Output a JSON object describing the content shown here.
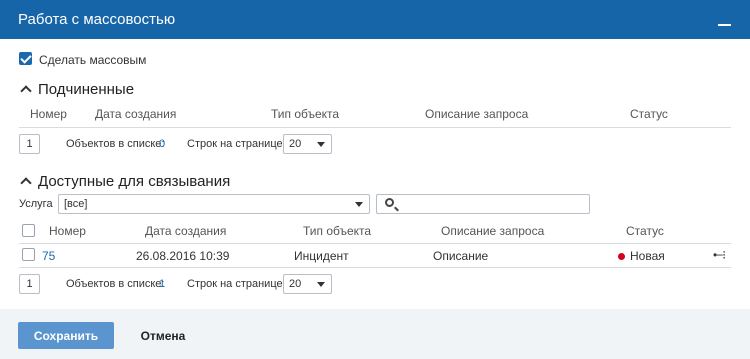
{
  "dialog": {
    "title": "Работа с массовостью"
  },
  "make_mass": {
    "label": "Сделать массовым",
    "checked": true
  },
  "subordinates": {
    "title": "Подчиненные",
    "columns": [
      "Номер",
      "Дата создания",
      "Тип объекта",
      "Описание запроса",
      "Статус"
    ],
    "pager": {
      "page": "1",
      "objects_label": "Объектов в списке:",
      "objects_count": "0",
      "rows_label": "Строк на странице:",
      "rows_value": "20"
    }
  },
  "available": {
    "title": "Доступные для связывания",
    "service_label": "Услуга",
    "service_value": "[все]",
    "search_placeholder": "",
    "columns": [
      "Номер",
      "Дата создания",
      "Тип объекта",
      "Описание запроса",
      "Статус"
    ],
    "rows": [
      {
        "number": "75",
        "date": "26.08.2016 10:39",
        "type": "Инцидент",
        "description": "Описание",
        "status": "Новая",
        "status_color": "#d0021b"
      }
    ],
    "pager": {
      "page": "1",
      "objects_label": "Объектов в списке:",
      "objects_count": "1",
      "rows_label": "Строк на странице:",
      "rows_value": "20"
    }
  },
  "footer": {
    "save_label": "Сохранить",
    "cancel_label": "Отмена"
  },
  "icons": {
    "minimize": "minimize-icon",
    "collapse": "chevron-up-icon",
    "search": "search-icon",
    "link": "link-icon",
    "dropdown": "caret-down-icon"
  },
  "colors": {
    "header_bg": "#1565a8",
    "accent": "#1c68ad",
    "save_button": "#5a95cf",
    "footer_bg": "#f1f4f7"
  }
}
